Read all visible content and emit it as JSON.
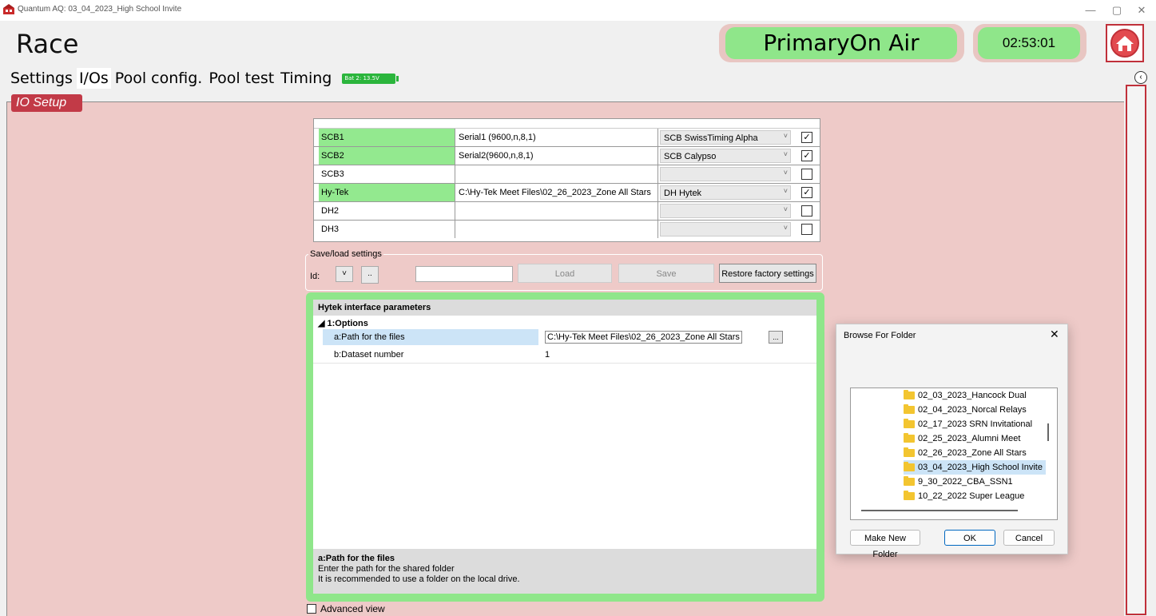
{
  "window": {
    "title": "Quantum AQ: 03_04_2023_High School Invite",
    "controls": {
      "minimize": "—",
      "maximize": "▢",
      "close": "✕"
    }
  },
  "header": {
    "title": "Race",
    "status": "PrimaryOn Air",
    "clock": "02:53:01"
  },
  "tabs": [
    {
      "label": "Settings",
      "active": false
    },
    {
      "label": "I/Os",
      "active": true
    },
    {
      "label": "Pool config.",
      "active": false
    },
    {
      "label": "Pool test",
      "active": false
    },
    {
      "label": "Timing",
      "active": false
    }
  ],
  "battery": {
    "label": "Bat 2: 13.5V"
  },
  "section": {
    "title": "IO Setup"
  },
  "io_rows": [
    {
      "name": "SCB1",
      "port": "Serial1 (9600,n,8,1)",
      "type": "SCB SwissTiming Alpha",
      "checked": true,
      "active": true
    },
    {
      "name": "SCB2",
      "port": "Serial2(9600,n,8,1)",
      "type": "SCB Calypso",
      "checked": true,
      "active": true
    },
    {
      "name": "SCB3",
      "port": "",
      "type": "",
      "checked": false,
      "active": false
    },
    {
      "name": "Hy-Tek",
      "port": "C:\\Hy-Tek Meet Files\\02_26_2023_Zone All Stars",
      "type": "DH Hytek",
      "checked": true,
      "active": true
    },
    {
      "name": "DH2",
      "port": "",
      "type": "",
      "checked": false,
      "active": false
    },
    {
      "name": "DH3",
      "port": "",
      "type": "",
      "checked": false,
      "active": false
    }
  ],
  "save_load": {
    "legend": "Save/load settings",
    "id_label": "Id:",
    "id_dropdown": "˅",
    "browse": "..",
    "load": "Load",
    "save": "Save",
    "restore": "Restore factory settings"
  },
  "hytek": {
    "title": "Hytek interface parameters",
    "category": "1:Options",
    "params": [
      {
        "key": "a:Path for the files",
        "value": "C:\\Hy-Tek Meet Files\\02_26_2023_Zone All Stars",
        "selected": true
      },
      {
        "key": "b:Dataset number",
        "value": "1",
        "selected": false
      }
    ],
    "browse_button": "...",
    "desc_title": "a:Path for the files",
    "desc_line1": "Enter the path for the shared folder",
    "desc_line2": "It is recommended to use a folder on the local drive."
  },
  "advanced_view": {
    "label": "Advanced view",
    "checked": false
  },
  "dialog": {
    "title": "Browse For Folder",
    "close": "✕",
    "folders": [
      {
        "name": "02_03_2023_Hancock Dual",
        "selected": false
      },
      {
        "name": "02_04_2023_Norcal Relays",
        "selected": false
      },
      {
        "name": "02_17_2023 SRN Invitational",
        "selected": false
      },
      {
        "name": "02_25_2023_Alumni Meet",
        "selected": false
      },
      {
        "name": "02_26_2023_Zone All Stars",
        "selected": false
      },
      {
        "name": "03_04_2023_High School Invite",
        "selected": true
      },
      {
        "name": "9_30_2022_CBA_SSN1",
        "selected": false
      },
      {
        "name": "10_22_2022 Super League",
        "selected": false
      }
    ],
    "make_new_folder": "Make New Folder",
    "ok": "OK",
    "cancel": "Cancel"
  },
  "colors": {
    "accent_red": "#c23a47",
    "active_green": "#8fe68a",
    "panel_pink": "#eecac8"
  }
}
